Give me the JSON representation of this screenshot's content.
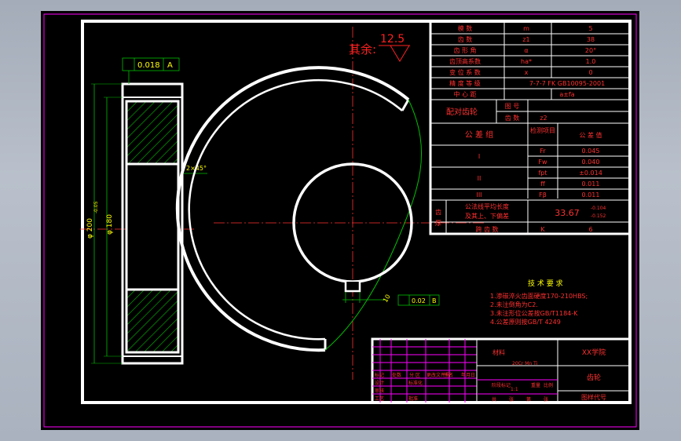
{
  "surface_finish": {
    "label": "其余:",
    "value": "12.5"
  },
  "dims": {
    "runout_tolerance": "0.018",
    "runout_datum": "A",
    "outer_diameter": "φ 200",
    "outer_diameter_tol": "-0.05",
    "bore_diameter": "φ 180",
    "chamfer": "2×45°",
    "keyway_tolerance": "0.02",
    "keyway_datum": "B",
    "keyway_width": "10"
  },
  "param_table": [
    [
      "模  数",
      "m",
      "5"
    ],
    [
      "齿  数",
      "z1",
      "38"
    ],
    [
      "齿 形 角",
      "α",
      "20°"
    ],
    [
      "齿顶高系数",
      "ha*",
      "1.0"
    ],
    [
      "变 位 系 数",
      "x",
      "0"
    ],
    [
      "精 度 等 级",
      "7-7-7 FK GB10095-2001"
    ],
    [
      "中 心 距",
      "a±fa"
    ]
  ],
  "mating": {
    "label": "配对齿轮",
    "rows": [
      [
        "图 号",
        ""
      ],
      [
        "齿 数",
        "z2"
      ]
    ]
  },
  "tolerance_group": {
    "header": [
      "公 差 组",
      "检测项目",
      "公 差 值"
    ],
    "groups": [
      {
        "name": "I",
        "rows": [
          [
            "Fr",
            "0.045"
          ],
          [
            "Fw",
            "0.040"
          ]
        ]
      },
      {
        "name": "II",
        "rows": [
          [
            "fpt",
            "±0.014"
          ],
          [
            "ff",
            "0.011"
          ]
        ]
      },
      {
        "name": "III",
        "rows": [
          [
            "Fβ",
            "0.011"
          ]
        ]
      }
    ]
  },
  "tooth_thickness": {
    "side_label": "齿厚",
    "desc_line1": "公法线平均长度",
    "desc_line2": "及其上、下偏差",
    "value": "33.67",
    "upper": "-0.104",
    "lower": "-0.152",
    "span_label": "跨 齿 数",
    "span_symbol": "K",
    "span_value": "6"
  },
  "tech_req": {
    "title": "技 术 要 求",
    "items": [
      "1.渗碳淬火齿面硬度170-210HBS;",
      "2.未注倒角为C2.",
      "3.未注形位公差按GB/T1184-K",
      "4.公差原则按GB/T 4249"
    ]
  },
  "title_block": {
    "material": "材料",
    "scale_note": "20Cr Mn Ti",
    "school": "XX学院",
    "part_name": "齿轮",
    "drawing_no": "图样代号",
    "rev_labels": [
      "标记",
      "处数",
      "分 区",
      "更改文件号",
      "签名",
      "年月日"
    ],
    "design": "设计",
    "standardize": "标准化",
    "review": "审核",
    "process": "工艺",
    "approve": "批准",
    "stage": "阶段标记",
    "weight": "重量",
    "scale": "比例",
    "scale_val": "1:1",
    "sheets": [
      "共",
      "张",
      "第",
      "张"
    ]
  }
}
